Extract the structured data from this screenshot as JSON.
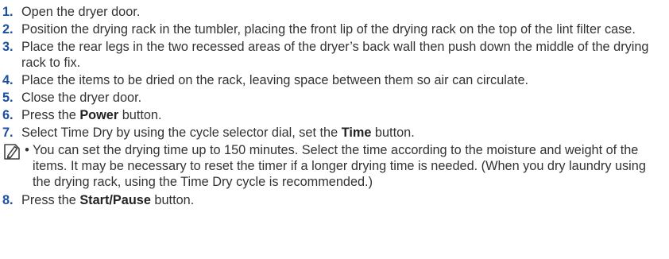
{
  "steps": [
    {
      "num": "1.",
      "text": "Open the dryer door."
    },
    {
      "num": "2.",
      "text": "Position the drying rack in the tumbler, placing the front lip of the drying rack on the top of the lint filter case."
    },
    {
      "num": "3.",
      "text": "Place the rear legs in the two recessed areas of the dryer’s back wall then push down the middle of the drying rack to fix."
    },
    {
      "num": "4.",
      "text": "Place the items to be dried on the rack, leaving space between them so air can circulate."
    },
    {
      "num": "5.",
      "text": "Close the dryer door."
    },
    {
      "num": "6.",
      "pre": "Press the ",
      "bold": "Power",
      "post": " button."
    },
    {
      "num": "7.",
      "pre": "Select Time Dry by using the cycle selector dial, set the ",
      "bold": "Time",
      "post": " button."
    },
    {
      "num": "8.",
      "pre": "Press the ",
      "bold": "Start/Pause",
      "post": " button."
    }
  ],
  "note": {
    "icon": "note-pencil-icon",
    "bullet": "•",
    "text": "You can set the drying time up to 150 minutes. Select the time according to the moisture and weight of the items. It may be necessary to reset the timer if a longer drying time is needed. (When you dry laundry using the drying rack, using the Time Dry cycle is recommended.)"
  },
  "colors": {
    "step_number": "#1b4fa0",
    "body_text": "#333333"
  }
}
